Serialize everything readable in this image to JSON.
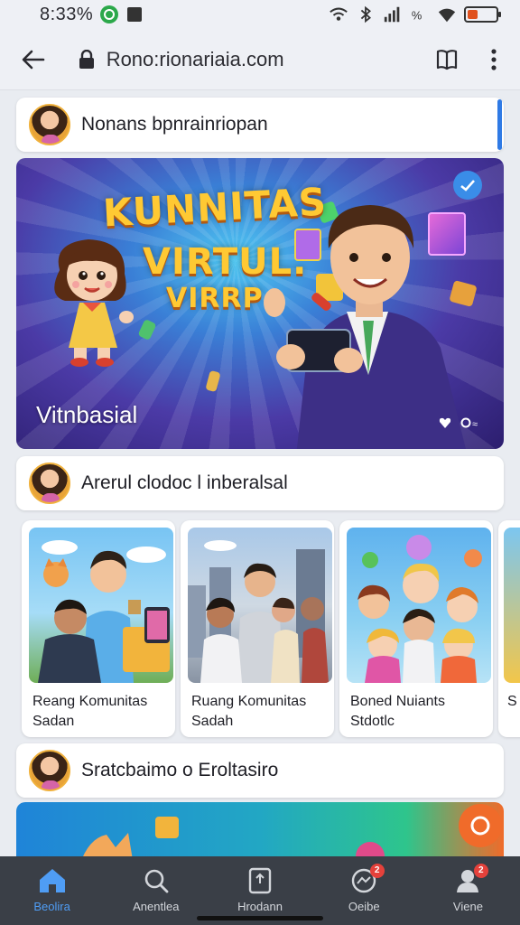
{
  "status_bar": {
    "time": "8:33% ",
    "battery_level": 0.35,
    "icons": [
      "app-notification-icon",
      "square-icon",
      "wifi-icon",
      "bluetooth-icon",
      "signal-icon",
      "data-icon",
      "wifi-icon",
      "battery-icon"
    ]
  },
  "browser": {
    "url": "Rono:rionariaia.com",
    "icons": [
      "back-arrow-icon",
      "lock-icon",
      "bookmark-icon",
      "more-vert-icon"
    ]
  },
  "post_rows": [
    {
      "text": "Nonans bpnrainriopan"
    },
    {
      "text": "Arerul clodoc l inberalsal"
    },
    {
      "text": "Sratcbaimo o Eroltasiro"
    }
  ],
  "hero": {
    "title_line1": "KUNNITAS",
    "title_line2": "VIRTUL.",
    "title_line3": "VIRRP",
    "caption": "Vitnbasial",
    "accent": "#ffc933"
  },
  "rooms": [
    {
      "line1": "Reang Komunitas",
      "line2": "Sadan"
    },
    {
      "line1": "Ruang Komunitas",
      "line2": "Sadah"
    },
    {
      "line1": "Boned Nuiants",
      "line2": "Stdotlc"
    },
    {
      "line1": "S",
      "line2": ""
    }
  ],
  "bottom_nav": [
    {
      "label": "Beolira",
      "icon": "home-icon",
      "active": true,
      "badge": ""
    },
    {
      "label": "Anentlea",
      "icon": "search-icon",
      "active": false,
      "badge": ""
    },
    {
      "label": "Hrodann",
      "icon": "upload-icon",
      "active": false,
      "badge": ""
    },
    {
      "label": "Oeibe",
      "icon": "chat-icon",
      "active": false,
      "badge": "2"
    },
    {
      "label": "Viene",
      "icon": "profile-icon",
      "active": false,
      "badge": "2"
    }
  ],
  "colors": {
    "active_nav": "#4f9df5",
    "nav_bg": "#3a3f47",
    "scroll_indicator": "#2f7ae5"
  }
}
